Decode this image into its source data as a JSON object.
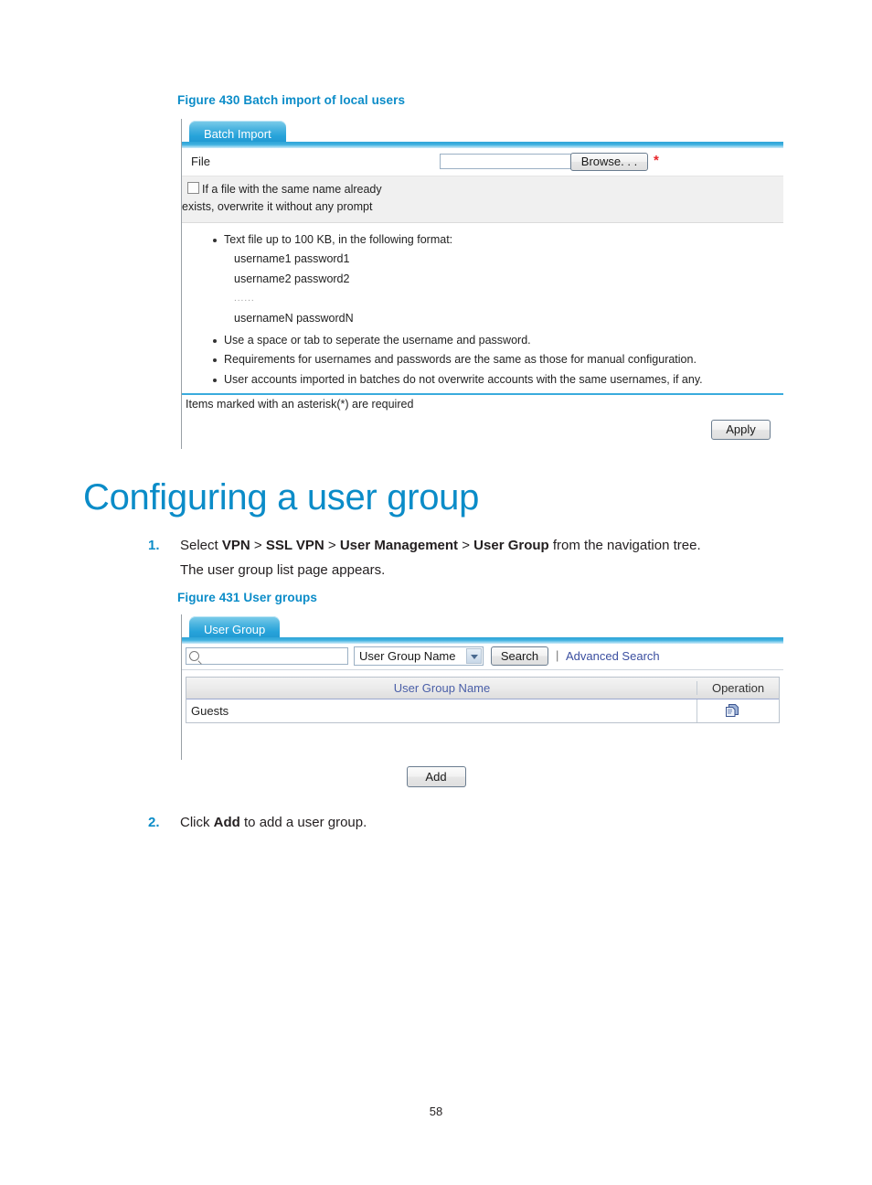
{
  "document": {
    "page_number": "58"
  },
  "figure430": {
    "caption": "Figure 430 Batch import of local users",
    "tab_label": "Batch Import",
    "file_label": "File",
    "file_value": "",
    "file_placeholder": "",
    "browse_label": "Browse. . .",
    "required_marker": "*",
    "overwrite_checkbox_line1": "If a file with the same name already",
    "overwrite_checkbox_line2": "exists, overwrite it without any prompt",
    "overwrite_checked": false,
    "notes": [
      {
        "style": "bulleted",
        "text": "Text file up to 100 KB, in the following format:"
      },
      {
        "style": "plain",
        "text": "username1 password1"
      },
      {
        "style": "plain",
        "text": "username2 password2"
      },
      {
        "style": "dots",
        "text": "......"
      },
      {
        "style": "plain",
        "text": "usernameN passwordN"
      },
      {
        "style": "bulleted",
        "text": "Use a space or tab to seperate the username and password."
      },
      {
        "style": "bulleted",
        "text": "Requirements for usernames and passwords are the same as those for manual configuration."
      },
      {
        "style": "bulleted",
        "text": "User accounts imported in batches do not overwrite accounts with the same usernames, if any."
      }
    ],
    "footnote": "Items marked with an asterisk(*) are required",
    "apply_label": "Apply"
  },
  "section": {
    "heading": "Configuring a user group",
    "steps": [
      {
        "number": "1.",
        "parts": [
          {
            "text": "Select ",
            "bold": false
          },
          {
            "text": "VPN",
            "bold": true
          },
          {
            "text": " > ",
            "bold": false
          },
          {
            "text": "SSL VPN",
            "bold": true
          },
          {
            "text": " > ",
            "bold": false
          },
          {
            "text": "User Management",
            "bold": true
          },
          {
            "text": " > ",
            "bold": false
          },
          {
            "text": "User Group",
            "bold": true
          },
          {
            "text": " from the navigation tree.",
            "bold": false
          }
        ],
        "continuation": "The user group list page appears."
      },
      {
        "number": "2.",
        "parts": [
          {
            "text": "Click ",
            "bold": false
          },
          {
            "text": "Add",
            "bold": true
          },
          {
            "text": " to add a user group.",
            "bold": false
          }
        ],
        "continuation": ""
      }
    ]
  },
  "figure431": {
    "caption": "Figure 431 User groups",
    "tab_label": "User Group",
    "search_value": "",
    "search_placeholder": "",
    "search_field_selected": "User Group Name",
    "search_field_options": [
      "User Group Name"
    ],
    "search_button_label": "Search",
    "divider": "|",
    "advanced_search_label": "Advanced Search",
    "table": {
      "columns": [
        "User Group Name",
        "Operation"
      ],
      "rows": [
        {
          "name": "Guests",
          "operation_icon": "edit-document-icon"
        }
      ]
    },
    "add_label": "Add"
  },
  "colors": {
    "accent_blue": "#0b8cc8",
    "tab_blue": "#27a3da",
    "link_blue": "#3b4fa0",
    "required_red": "#e8262b",
    "header_text_blue": "#4a5fa8"
  }
}
